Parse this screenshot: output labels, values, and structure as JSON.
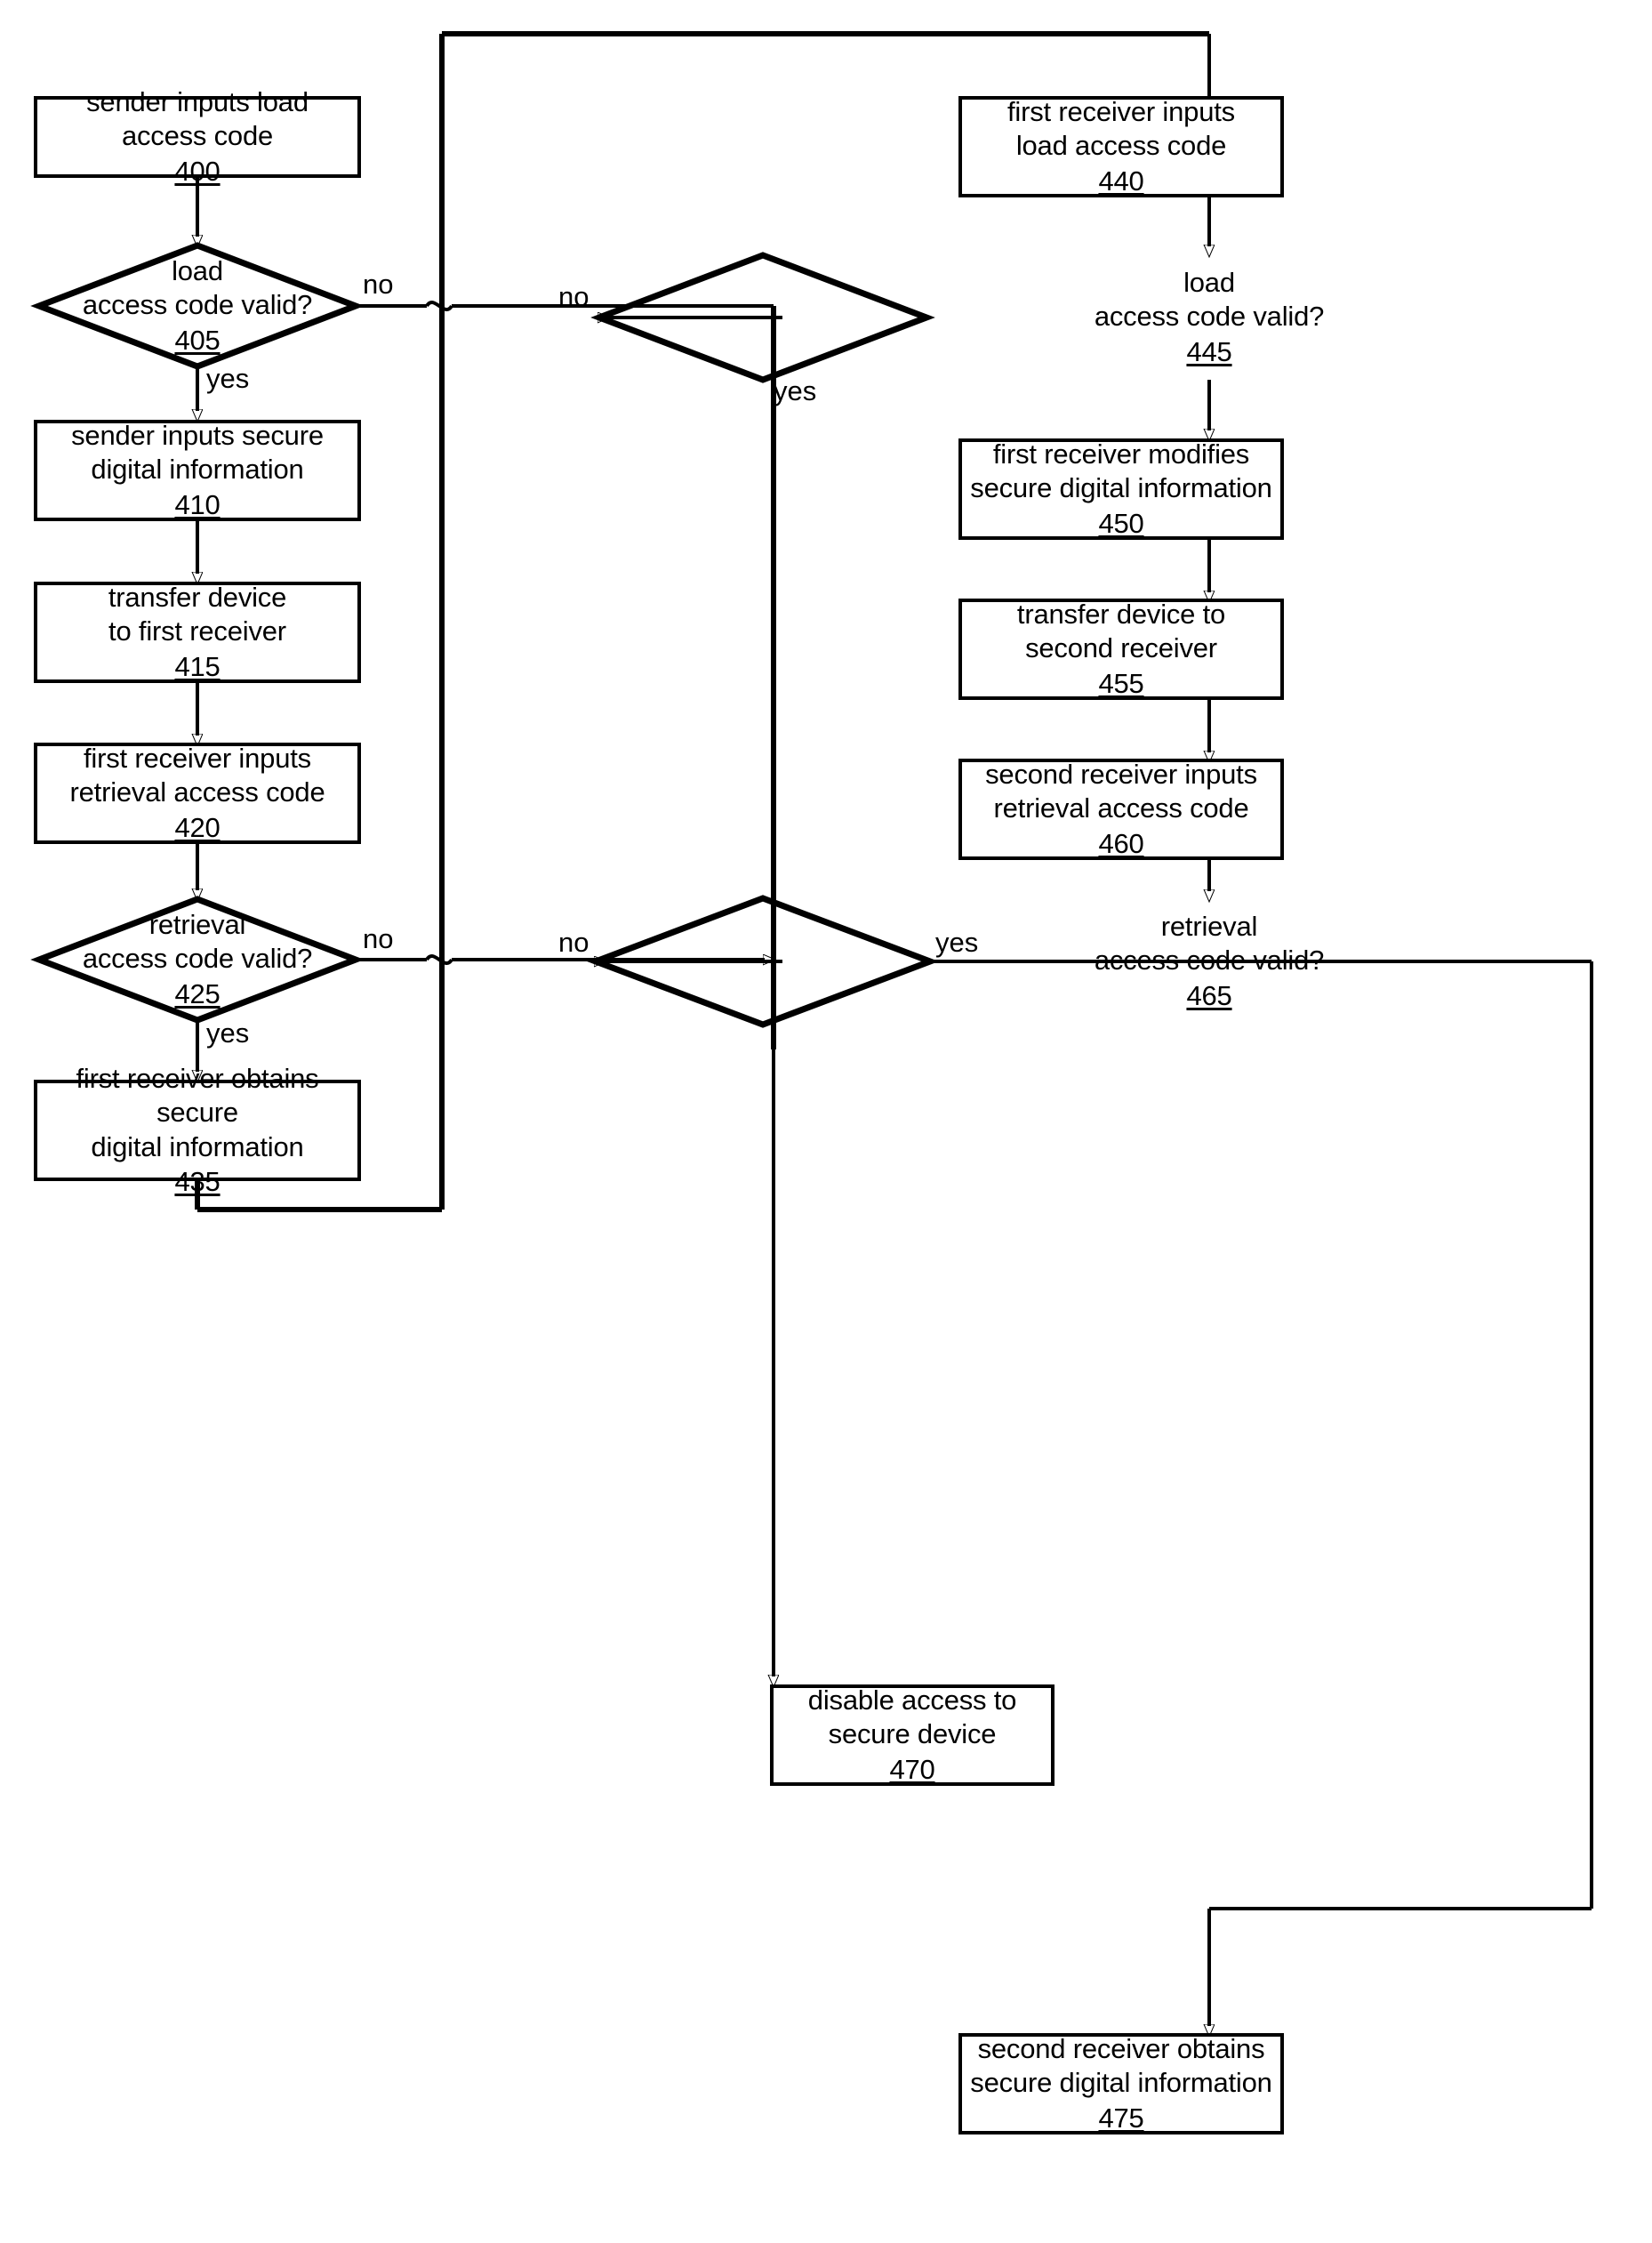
{
  "figure": {
    "type": "flowchart",
    "orientation": "two-column",
    "background": "#ffffff",
    "line_color": "#000000"
  },
  "nodes": [
    {
      "id": "n400",
      "shape": "process",
      "label": "sender inputs load access code",
      "ref": "400"
    },
    {
      "id": "n405",
      "shape": "decision",
      "label": "load\naccess code valid?",
      "ref": "405"
    },
    {
      "id": "n410",
      "shape": "process",
      "label": "sender inputs secure\ndigital information",
      "ref": "410"
    },
    {
      "id": "n415",
      "shape": "process",
      "label": "transfer device\nto first receiver",
      "ref": "415"
    },
    {
      "id": "n420",
      "shape": "process",
      "label": "first receiver inputs\nretrieval access code",
      "ref": "420"
    },
    {
      "id": "n425",
      "shape": "decision",
      "label": "retrieval\naccess code valid?",
      "ref": "425"
    },
    {
      "id": "n435",
      "shape": "process",
      "label": "first receiver obtains secure\ndigital information",
      "ref": "435"
    },
    {
      "id": "n440",
      "shape": "process",
      "label": "first receiver inputs\nload access code",
      "ref": "440"
    },
    {
      "id": "n445",
      "shape": "decision",
      "label": "load\naccess code valid?",
      "ref": "445"
    },
    {
      "id": "n450",
      "shape": "process",
      "label": "first receiver modifies\nsecure digital information",
      "ref": "450"
    },
    {
      "id": "n455",
      "shape": "process",
      "label": "transfer device to\nsecond receiver",
      "ref": "455"
    },
    {
      "id": "n460",
      "shape": "process",
      "label": "second receiver inputs\nretrieval access code",
      "ref": "460"
    },
    {
      "id": "n465",
      "shape": "decision",
      "label": "retrieval\naccess code valid?",
      "ref": "465"
    },
    {
      "id": "n470",
      "shape": "process",
      "label": "disable access to\nsecure device",
      "ref": "470"
    },
    {
      "id": "n475",
      "shape": "process",
      "label": "second receiver obtains\nsecure digital information",
      "ref": "475"
    }
  ],
  "edge_labels": {
    "e405_no": "no",
    "e405_yes": "yes",
    "e425_no": "no",
    "e425_yes": "yes",
    "e445_no": "no",
    "e445_yes": "yes",
    "e465_no": "no",
    "e465_yes": "yes"
  },
  "edges": [
    {
      "from": "400",
      "to": "405",
      "label": ""
    },
    {
      "from": "405",
      "to": "disable-path",
      "label": "no"
    },
    {
      "from": "405",
      "to": "410",
      "label": "yes"
    },
    {
      "from": "410",
      "to": "415",
      "label": ""
    },
    {
      "from": "415",
      "to": "420",
      "label": ""
    },
    {
      "from": "420",
      "to": "425",
      "label": ""
    },
    {
      "from": "425",
      "to": "disable-path",
      "label": "no"
    },
    {
      "from": "425",
      "to": "435",
      "label": "yes"
    },
    {
      "from": "435",
      "to": "440",
      "label": ""
    },
    {
      "from": "440",
      "to": "445",
      "label": ""
    },
    {
      "from": "445",
      "to": "disable-path",
      "label": "no"
    },
    {
      "from": "445",
      "to": "450",
      "label": "yes"
    },
    {
      "from": "450",
      "to": "455",
      "label": ""
    },
    {
      "from": "455",
      "to": "460",
      "label": ""
    },
    {
      "from": "460",
      "to": "465",
      "label": ""
    },
    {
      "from": "465",
      "to": "470",
      "label": "no"
    },
    {
      "from": "465",
      "to": "475",
      "label": "yes"
    }
  ]
}
